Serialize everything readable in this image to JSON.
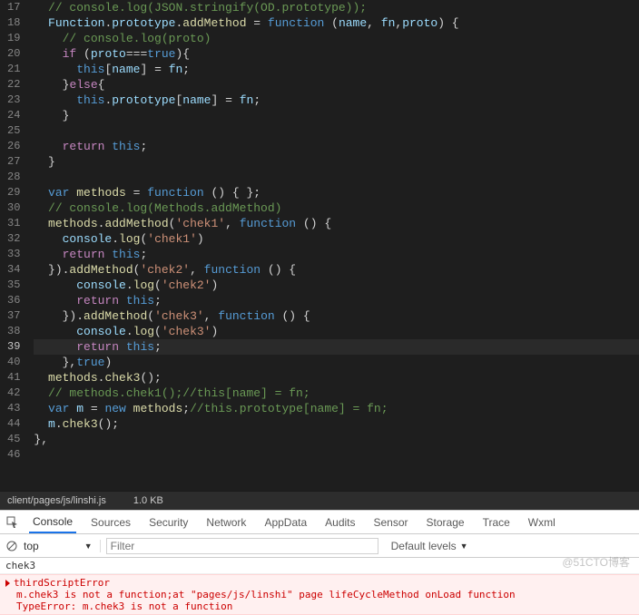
{
  "editor": {
    "startLine": 17,
    "currentLine": 39,
    "lines": [
      {
        "n": 17,
        "tokens": [
          {
            "t": "  ",
            "c": ""
          },
          {
            "t": "// console.log(JSON.stringify(OD.prototype));",
            "c": "cmt"
          }
        ]
      },
      {
        "n": 18,
        "tokens": [
          {
            "t": "  ",
            "c": ""
          },
          {
            "t": "Function",
            "c": "var"
          },
          {
            "t": ".",
            "c": "punc"
          },
          {
            "t": "prototype",
            "c": "prop"
          },
          {
            "t": ".",
            "c": "punc"
          },
          {
            "t": "addMethod",
            "c": "fn"
          },
          {
            "t": " = ",
            "c": "punc"
          },
          {
            "t": "function",
            "c": "kw"
          },
          {
            "t": " (",
            "c": "punc"
          },
          {
            "t": "name",
            "c": "prop"
          },
          {
            "t": ", ",
            "c": "punc"
          },
          {
            "t": "fn",
            "c": "prop"
          },
          {
            "t": ",",
            "c": "punc"
          },
          {
            "t": "proto",
            "c": "prop"
          },
          {
            "t": ") {",
            "c": "punc"
          }
        ]
      },
      {
        "n": 19,
        "tokens": [
          {
            "t": "    ",
            "c": ""
          },
          {
            "t": "// console.log(proto)",
            "c": "cmt"
          }
        ]
      },
      {
        "n": 20,
        "tokens": [
          {
            "t": "    ",
            "c": ""
          },
          {
            "t": "if",
            "c": "kw2"
          },
          {
            "t": " (",
            "c": "punc"
          },
          {
            "t": "proto",
            "c": "prop"
          },
          {
            "t": "===",
            "c": "punc"
          },
          {
            "t": "true",
            "c": "kw"
          },
          {
            "t": "){",
            "c": "punc"
          }
        ]
      },
      {
        "n": 21,
        "tokens": [
          {
            "t": "      ",
            "c": ""
          },
          {
            "t": "this",
            "c": "kw"
          },
          {
            "t": "[",
            "c": "punc"
          },
          {
            "t": "name",
            "c": "prop"
          },
          {
            "t": "] = ",
            "c": "punc"
          },
          {
            "t": "fn",
            "c": "prop"
          },
          {
            "t": ";",
            "c": "punc"
          }
        ]
      },
      {
        "n": 22,
        "tokens": [
          {
            "t": "    ",
            "c": ""
          },
          {
            "t": "}",
            "c": "punc"
          },
          {
            "t": "else",
            "c": "kw2"
          },
          {
            "t": "{",
            "c": "punc"
          }
        ]
      },
      {
        "n": 23,
        "tokens": [
          {
            "t": "      ",
            "c": ""
          },
          {
            "t": "this",
            "c": "kw"
          },
          {
            "t": ".",
            "c": "punc"
          },
          {
            "t": "prototype",
            "c": "prop"
          },
          {
            "t": "[",
            "c": "punc"
          },
          {
            "t": "name",
            "c": "prop"
          },
          {
            "t": "] = ",
            "c": "punc"
          },
          {
            "t": "fn",
            "c": "prop"
          },
          {
            "t": ";",
            "c": "punc"
          }
        ]
      },
      {
        "n": 24,
        "tokens": [
          {
            "t": "    ",
            "c": ""
          },
          {
            "t": "}",
            "c": "punc"
          }
        ]
      },
      {
        "n": 25,
        "tokens": [
          {
            "t": "",
            "c": ""
          }
        ]
      },
      {
        "n": 26,
        "tokens": [
          {
            "t": "    ",
            "c": ""
          },
          {
            "t": "return",
            "c": "kw2"
          },
          {
            "t": " ",
            "c": ""
          },
          {
            "t": "this",
            "c": "kw"
          },
          {
            "t": ";",
            "c": "punc"
          }
        ]
      },
      {
        "n": 27,
        "tokens": [
          {
            "t": "  ",
            "c": ""
          },
          {
            "t": "}",
            "c": "punc"
          }
        ]
      },
      {
        "n": 28,
        "tokens": [
          {
            "t": "",
            "c": ""
          }
        ]
      },
      {
        "n": 29,
        "tokens": [
          {
            "t": "  ",
            "c": ""
          },
          {
            "t": "var",
            "c": "kw"
          },
          {
            "t": " ",
            "c": ""
          },
          {
            "t": "methods",
            "c": "fn"
          },
          {
            "t": " = ",
            "c": "punc"
          },
          {
            "t": "function",
            "c": "kw"
          },
          {
            "t": " () { };",
            "c": "punc"
          }
        ]
      },
      {
        "n": 30,
        "tokens": [
          {
            "t": "  ",
            "c": ""
          },
          {
            "t": "// console.log(Methods.addMethod)",
            "c": "cmt"
          }
        ]
      },
      {
        "n": 31,
        "tokens": [
          {
            "t": "  ",
            "c": ""
          },
          {
            "t": "methods",
            "c": "fn"
          },
          {
            "t": ".",
            "c": "punc"
          },
          {
            "t": "addMethod",
            "c": "fn"
          },
          {
            "t": "(",
            "c": "punc"
          },
          {
            "t": "'chek1'",
            "c": "str"
          },
          {
            "t": ", ",
            "c": "punc"
          },
          {
            "t": "function",
            "c": "kw"
          },
          {
            "t": " () {",
            "c": "punc"
          }
        ]
      },
      {
        "n": 32,
        "tokens": [
          {
            "t": "    ",
            "c": ""
          },
          {
            "t": "console",
            "c": "var"
          },
          {
            "t": ".",
            "c": "punc"
          },
          {
            "t": "log",
            "c": "fn"
          },
          {
            "t": "(",
            "c": "punc"
          },
          {
            "t": "'chek1'",
            "c": "str"
          },
          {
            "t": ")",
            "c": "punc"
          }
        ]
      },
      {
        "n": 33,
        "tokens": [
          {
            "t": "    ",
            "c": ""
          },
          {
            "t": "return",
            "c": "kw2"
          },
          {
            "t": " ",
            "c": ""
          },
          {
            "t": "this",
            "c": "kw"
          },
          {
            "t": ";",
            "c": "punc"
          }
        ]
      },
      {
        "n": 34,
        "tokens": [
          {
            "t": "  ",
            "c": ""
          },
          {
            "t": "}).",
            "c": "punc"
          },
          {
            "t": "addMethod",
            "c": "fn"
          },
          {
            "t": "(",
            "c": "punc"
          },
          {
            "t": "'chek2'",
            "c": "str"
          },
          {
            "t": ", ",
            "c": "punc"
          },
          {
            "t": "function",
            "c": "kw"
          },
          {
            "t": " () {",
            "c": "punc"
          }
        ]
      },
      {
        "n": 35,
        "tokens": [
          {
            "t": "      ",
            "c": ""
          },
          {
            "t": "console",
            "c": "var"
          },
          {
            "t": ".",
            "c": "punc"
          },
          {
            "t": "log",
            "c": "fn"
          },
          {
            "t": "(",
            "c": "punc"
          },
          {
            "t": "'chek2'",
            "c": "str"
          },
          {
            "t": ")",
            "c": "punc"
          }
        ]
      },
      {
        "n": 36,
        "tokens": [
          {
            "t": "      ",
            "c": ""
          },
          {
            "t": "return",
            "c": "kw2"
          },
          {
            "t": " ",
            "c": ""
          },
          {
            "t": "this",
            "c": "kw"
          },
          {
            "t": ";",
            "c": "punc"
          }
        ]
      },
      {
        "n": 37,
        "tokens": [
          {
            "t": "    ",
            "c": ""
          },
          {
            "t": "}).",
            "c": "punc"
          },
          {
            "t": "addMethod",
            "c": "fn"
          },
          {
            "t": "(",
            "c": "punc"
          },
          {
            "t": "'chek3'",
            "c": "str"
          },
          {
            "t": ", ",
            "c": "punc"
          },
          {
            "t": "function",
            "c": "kw"
          },
          {
            "t": " () {",
            "c": "punc"
          }
        ]
      },
      {
        "n": 38,
        "tokens": [
          {
            "t": "      ",
            "c": ""
          },
          {
            "t": "console",
            "c": "var"
          },
          {
            "t": ".",
            "c": "punc"
          },
          {
            "t": "log",
            "c": "fn"
          },
          {
            "t": "(",
            "c": "punc"
          },
          {
            "t": "'chek3'",
            "c": "str"
          },
          {
            "t": ")",
            "c": "punc"
          }
        ]
      },
      {
        "n": 39,
        "tokens": [
          {
            "t": "      ",
            "c": ""
          },
          {
            "t": "return",
            "c": "kw2"
          },
          {
            "t": " ",
            "c": ""
          },
          {
            "t": "this",
            "c": "kw"
          },
          {
            "t": ";",
            "c": "punc"
          }
        ]
      },
      {
        "n": 40,
        "tokens": [
          {
            "t": "    ",
            "c": ""
          },
          {
            "t": "},",
            "c": "punc"
          },
          {
            "t": "true",
            "c": "kw"
          },
          {
            "t": ")",
            "c": "punc"
          }
        ]
      },
      {
        "n": 41,
        "tokens": [
          {
            "t": "  ",
            "c": ""
          },
          {
            "t": "methods",
            "c": "fn"
          },
          {
            "t": ".",
            "c": "punc"
          },
          {
            "t": "chek3",
            "c": "fn"
          },
          {
            "t": "();",
            "c": "punc"
          }
        ]
      },
      {
        "n": 42,
        "tokens": [
          {
            "t": "  ",
            "c": ""
          },
          {
            "t": "// methods.chek1();//this[name] = fn;",
            "c": "cmt"
          }
        ]
      },
      {
        "n": 43,
        "tokens": [
          {
            "t": "  ",
            "c": ""
          },
          {
            "t": "var",
            "c": "kw"
          },
          {
            "t": " ",
            "c": ""
          },
          {
            "t": "m",
            "c": "prop"
          },
          {
            "t": " = ",
            "c": "punc"
          },
          {
            "t": "new",
            "c": "kw"
          },
          {
            "t": " ",
            "c": ""
          },
          {
            "t": "methods",
            "c": "fn"
          },
          {
            "t": ";",
            "c": "punc"
          },
          {
            "t": "//this.prototype[name] = fn;",
            "c": "cmt"
          }
        ]
      },
      {
        "n": 44,
        "tokens": [
          {
            "t": "  ",
            "c": ""
          },
          {
            "t": "m",
            "c": "prop"
          },
          {
            "t": ".",
            "c": "punc"
          },
          {
            "t": "chek3",
            "c": "fn"
          },
          {
            "t": "();",
            "c": "punc"
          }
        ]
      },
      {
        "n": 45,
        "tokens": [
          {
            "t": "},",
            "c": "punc"
          }
        ]
      },
      {
        "n": 46,
        "tokens": [
          {
            "t": "",
            "c": ""
          }
        ]
      }
    ]
  },
  "statusbar": {
    "path": "client/pages/js/linshi.js",
    "size": "1.0 KB"
  },
  "devtools": {
    "tabs": [
      "Console",
      "Sources",
      "Security",
      "Network",
      "AppData",
      "Audits",
      "Sensor",
      "Storage",
      "Trace",
      "Wxml"
    ],
    "activeTab": 0,
    "context": "top",
    "filterPlaceholder": "Filter",
    "levels": "Default levels",
    "logs": [
      {
        "type": "log",
        "text": "chek3"
      },
      {
        "type": "error",
        "lines": [
          "thirdScriptError",
          "m.chek3 is not a function;at \"pages/js/linshi\" page lifeCycleMethod onLoad function",
          "TypeError: m.chek3 is not a function"
        ]
      }
    ]
  },
  "watermark": "@51CTO博客"
}
